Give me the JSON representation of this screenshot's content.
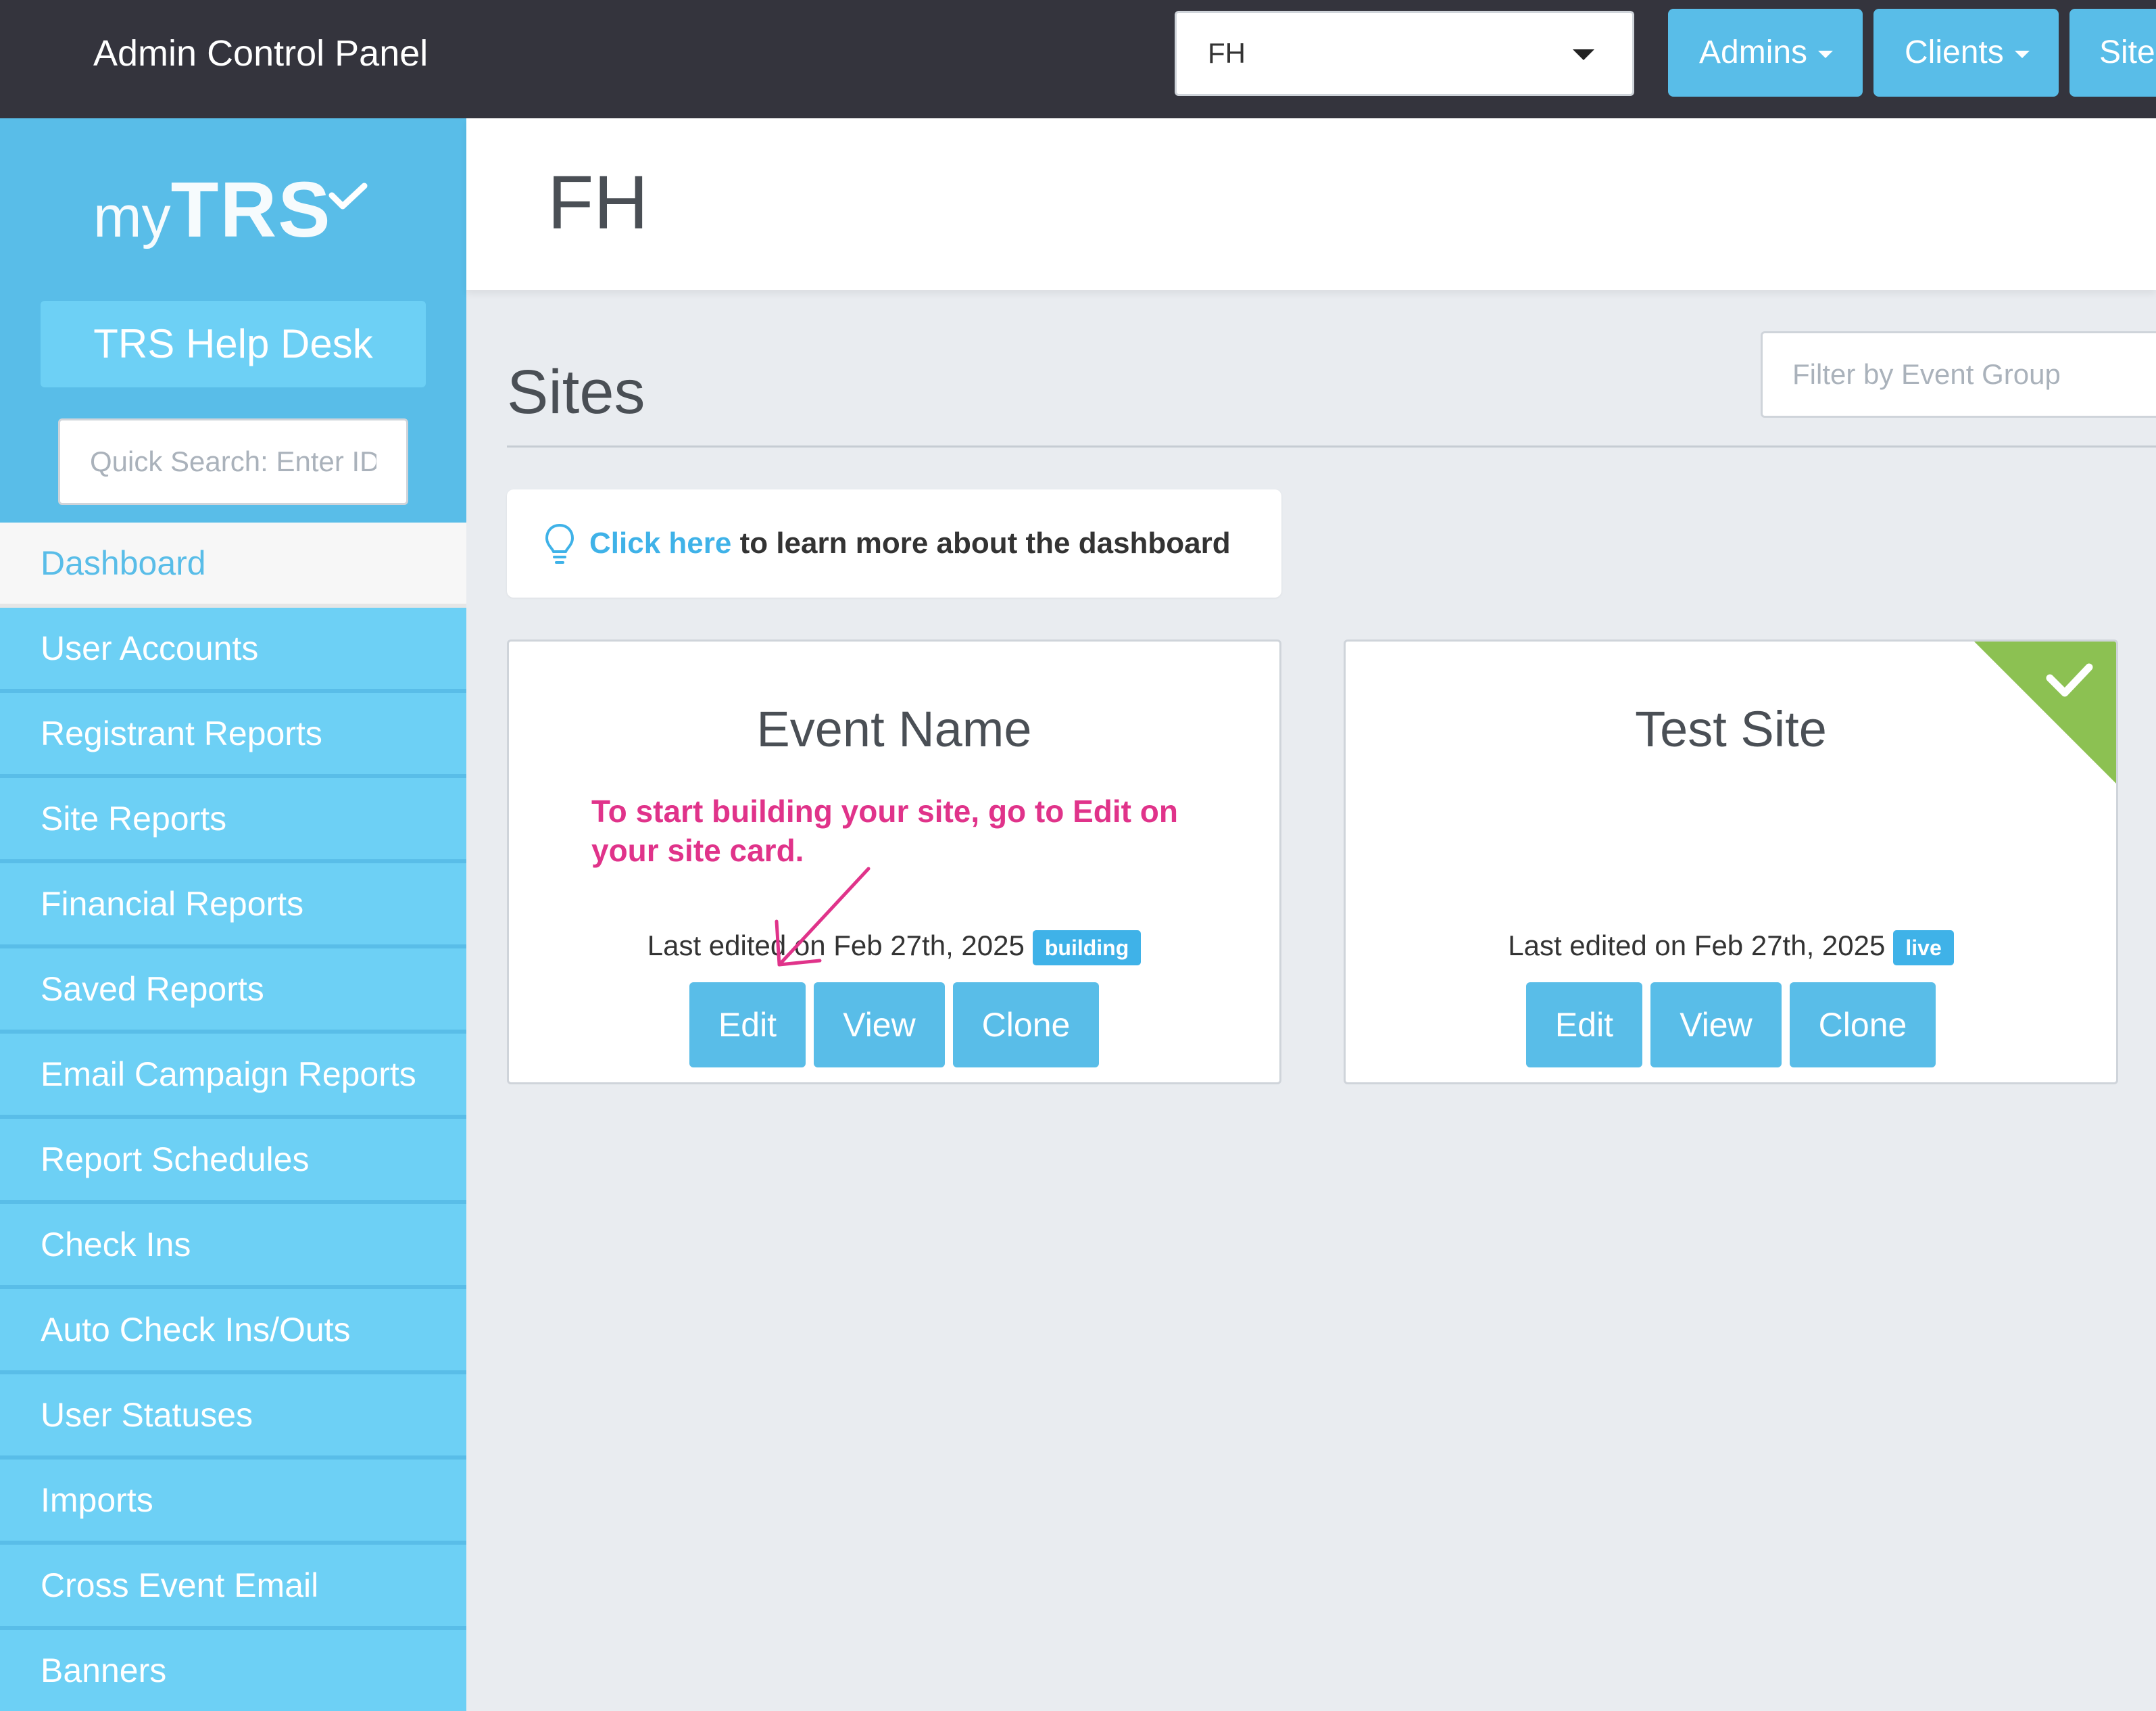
{
  "topbar": {
    "title": "Admin Control Panel",
    "client_select_value": "FH",
    "nav": [
      {
        "label": "Admins"
      },
      {
        "label": "Clients"
      },
      {
        "label": "Site"
      }
    ]
  },
  "sidebar": {
    "logo_my": "my",
    "logo_trs": "TRS",
    "helpdesk_label": "TRS Help Desk",
    "quick_search_placeholder": "Quick Search: Enter ID, first name, last name or email",
    "items": [
      {
        "label": "Dashboard",
        "active": true
      },
      {
        "label": "User Accounts"
      },
      {
        "label": "Registrant Reports"
      },
      {
        "label": "Site Reports"
      },
      {
        "label": "Financial Reports"
      },
      {
        "label": "Saved Reports"
      },
      {
        "label": "Email Campaign Reports"
      },
      {
        "label": "Report Schedules"
      },
      {
        "label": "Check Ins"
      },
      {
        "label": "Auto Check Ins/Outs"
      },
      {
        "label": "User Statuses"
      },
      {
        "label": "Imports"
      },
      {
        "label": "Cross Event Email"
      },
      {
        "label": "Banners"
      }
    ]
  },
  "main": {
    "page_title": "FH",
    "sites_heading": "Sites",
    "filter_placeholder": "Filter by Event Group",
    "tip": {
      "link": "Click here",
      "text": " to learn more about the dashboard"
    },
    "annotation": "To start building your site, go to Edit on your site card.",
    "cards": [
      {
        "title": "Event Name",
        "last_edited": "Last edited on Feb 27th, 2025",
        "status": "building",
        "buttons": {
          "edit": "Edit",
          "view": "View",
          "clone": "Clone"
        }
      },
      {
        "title": "Test Site",
        "last_edited": "Last edited on Feb 27th, 2025",
        "status": "live",
        "buttons": {
          "edit": "Edit",
          "view": "View",
          "clone": "Clone"
        }
      }
    ]
  },
  "colors": {
    "topbar": "#34343d",
    "accent": "#59bde8",
    "sidebar_item": "#6dd0f5",
    "annotation": "#e0338a",
    "live_ribbon": "#8cc152"
  }
}
